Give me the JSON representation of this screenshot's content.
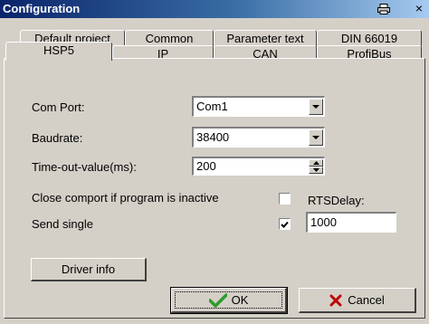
{
  "window": {
    "title": "Configuration",
    "close_glyph": "×"
  },
  "tabs_row1": [
    {
      "label": "Default project"
    },
    {
      "label": "Common"
    },
    {
      "label": "Parameter text"
    },
    {
      "label": "DIN 66019"
    }
  ],
  "tabs_row2": [
    {
      "label": "HSP5",
      "selected": true
    },
    {
      "label": "IP"
    },
    {
      "label": "CAN"
    },
    {
      "label": "ProfiBus"
    }
  ],
  "form": {
    "com_port_label": "Com Port:",
    "com_port_value": "Com1",
    "baudrate_label": "Baudrate:",
    "baudrate_value": "38400",
    "timeout_label": "Time-out-value(ms):",
    "timeout_value": "200",
    "close_comport_label": "Close comport if program is inactive",
    "close_comport_checked": false,
    "send_single_label": "Send single",
    "send_single_checked": true,
    "rts_delay_label": "RTSDelay:",
    "rts_delay_value": "1000",
    "driver_info_label": "Driver info"
  },
  "buttons": {
    "ok_label": "OK",
    "cancel_label": "Cancel"
  },
  "colors": {
    "title_bar": "#0a246a",
    "ok_check": "#2e9a2e",
    "cancel_x": "#c00000"
  }
}
